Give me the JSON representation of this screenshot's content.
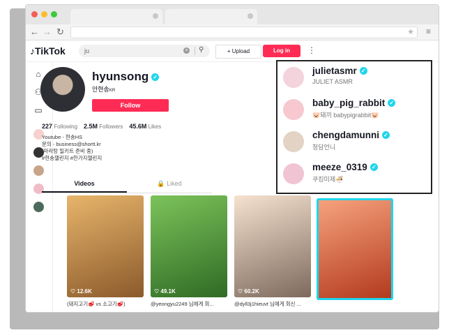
{
  "browser": {
    "nav_back": "←",
    "nav_forward": "→",
    "nav_reload": "↻",
    "star": "★",
    "menu": "≡"
  },
  "header": {
    "logo": "TikTok",
    "search_value": "ju",
    "clear_icon": "×",
    "search_icon": "⚲",
    "upload_label": "Upload",
    "login_label": "Log in",
    "more_icon": "⋮"
  },
  "profile": {
    "username": "hyunsong",
    "nickname": "안현송",
    "region": "KR",
    "follow_label": "Follow",
    "following_count": "227",
    "following_label": "Following",
    "followers_count": "2.5M",
    "followers_label": "Followers",
    "likes_count": "45.6M",
    "likes_label": "Likes",
    "bio": [
      "Youtube - 현송HS",
      "문의 - business@shortt.kr",
      "(마라탕 밀키트 준비 중)",
      "#현송챌린지 #한가지챌린지"
    ],
    "tabs": {
      "videos": "Videos",
      "liked": "Liked"
    }
  },
  "videos": [
    {
      "views": "12.6K",
      "caption": "(돼지고기🥩 vs 소고기🥩)",
      "colors": [
        "#d9a05a",
        "#8b5a2b"
      ]
    },
    {
      "views": "49.1K",
      "caption": "@yeongyu2249 님에게 회...",
      "colors": [
        "#5c9a3c",
        "#2f6b25"
      ]
    },
    {
      "views": "60.2K",
      "caption": "@dyll3j1hieuvt 님에게 회신 ...",
      "colors": [
        "#f0d6c0",
        "#8a6a55"
      ]
    },
    {
      "views": "",
      "caption": "",
      "colors": [
        "#e8744a",
        "#b33a1e"
      ]
    }
  ],
  "suggestions": [
    {
      "username": "julietasmr",
      "nickname": "JULIET ASMR",
      "avatar": "#f3d3dc"
    },
    {
      "username": "baby_pig_rabbit",
      "nickname": "🐷돼끼 babypigrabbit🐷",
      "avatar": "#f7c8cf"
    },
    {
      "username": "chengdamunni",
      "nickname": "청담언니",
      "avatar": "#e2d3c4"
    },
    {
      "username": "meeze_0319",
      "nickname": "쿠킹미제🍜",
      "avatar": "#f1c4d4"
    }
  ],
  "colors": {
    "brand": "#fe2c55",
    "verified": "#20d5ec",
    "highlight": "#20d5ec"
  }
}
